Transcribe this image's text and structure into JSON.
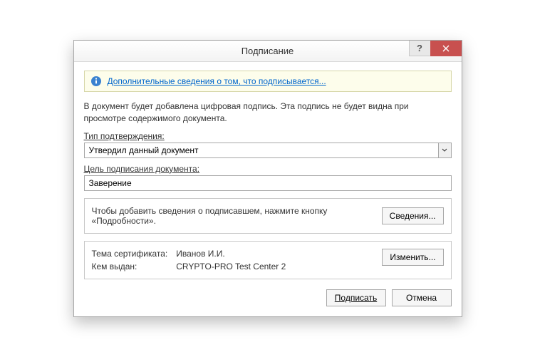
{
  "titlebar": {
    "title": "Подписание",
    "help": "?",
    "close": "×"
  },
  "info": {
    "link": "Дополнительные сведения о том, что подписывается..."
  },
  "desc": "В документ будет добавлена цифровая подпись. Эта подпись не будет видна при просмотре содержимого документа.",
  "type_label": "Тип подтверждения:",
  "type_value": "Утвердил данный документ",
  "purpose_label": "Цель подписания документа:",
  "purpose_value": "Заверение",
  "details_panel": {
    "text": "Чтобы добавить сведения о подписавшем, нажмите кнопку «Подробности».",
    "button": "Сведения..."
  },
  "cert": {
    "subject_label": "Тема сертификата:",
    "subject_value": "Иванов И.И.",
    "issuer_label": "Кем выдан:",
    "issuer_value": "CRYPTO-PRO Test Center 2",
    "change_button": "Изменить..."
  },
  "footer": {
    "sign": "Подписать",
    "cancel": "Отмена"
  }
}
